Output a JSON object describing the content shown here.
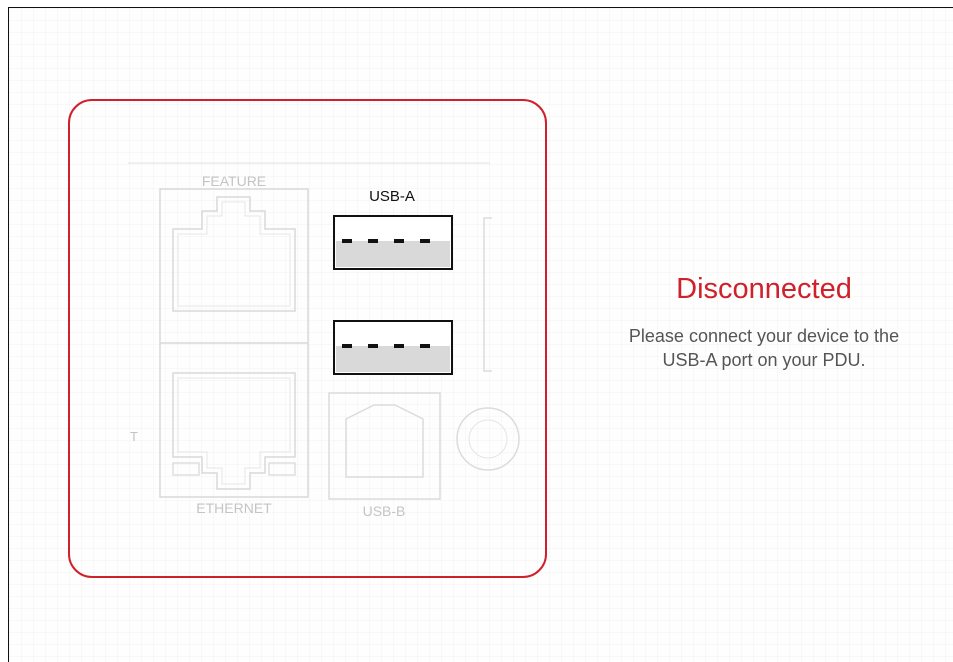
{
  "status": {
    "title": "Disconnected",
    "message_line1": "Please connect your device to the",
    "message_line2": "USB-A port on your PDU."
  },
  "ports": {
    "feature_label": "FEATURE",
    "ethernet_label": "ETHERNET",
    "usb_a_label": "USB-A",
    "usb_b_label": "USB-B",
    "edge_letter": "T"
  },
  "colors": {
    "accent": "#d0202a",
    "message_text": "#555555",
    "faded_outline": "#cfcfcf"
  },
  "icons": {
    "usb_a_port_top": "usb-a-port-icon",
    "usb_a_port_bottom": "usb-a-port-icon",
    "usb_b_port": "usb-b-port-icon",
    "feature_port": "rj45-port-icon",
    "ethernet_port": "rj45-port-icon"
  }
}
